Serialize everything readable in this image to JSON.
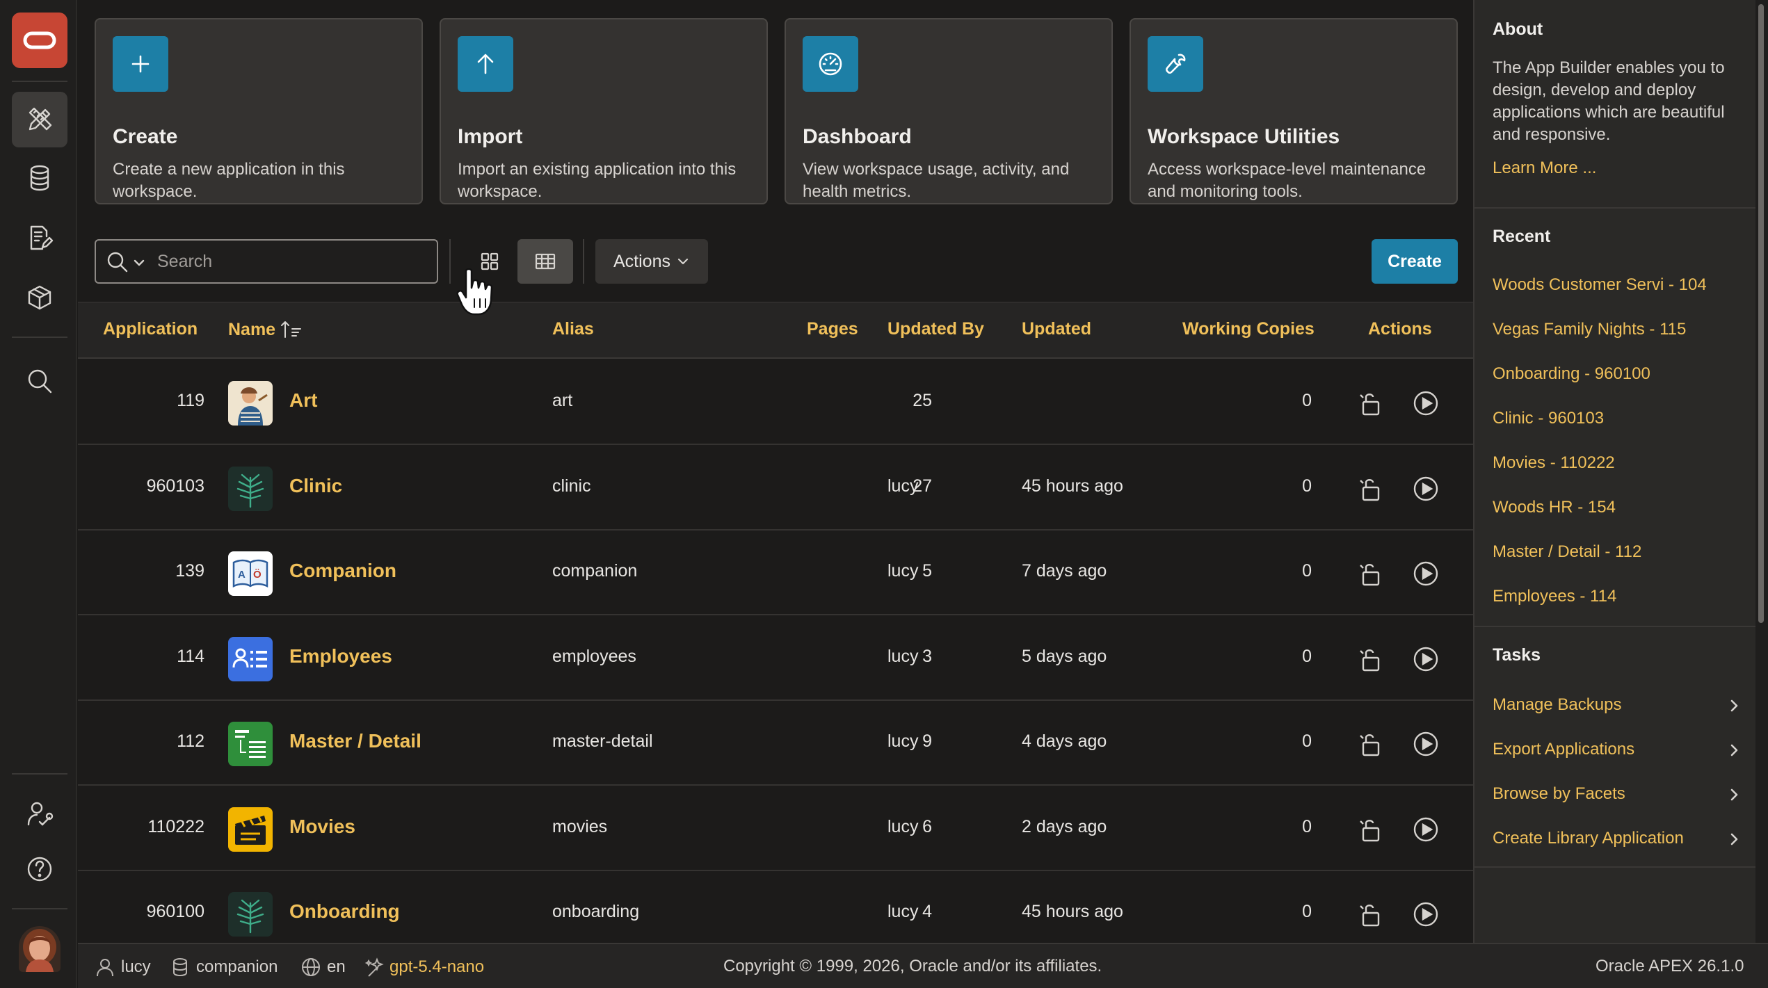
{
  "nav": {
    "items": [
      "app-builder",
      "sql-workshop",
      "team-development",
      "gallery",
      "search",
      "administration",
      "help"
    ]
  },
  "cards": [
    {
      "title": "Create",
      "description": "Create a new application in this workspace.",
      "icon": "plus-icon"
    },
    {
      "title": "Import",
      "description": "Import an existing application into this workspace.",
      "icon": "arrow-up-icon"
    },
    {
      "title": "Dashboard",
      "description": "View workspace usage, activity, and health metrics.",
      "icon": "gauge-icon"
    },
    {
      "title": "Workspace Utilities",
      "description": "Access workspace-level maintenance and monitoring tools.",
      "icon": "wrench-icon"
    }
  ],
  "toolbar": {
    "search_placeholder": "Search",
    "search_value": "",
    "actions_label": "Actions",
    "create_label": "Create",
    "view_mode": "report"
  },
  "table": {
    "columns": {
      "application": "Application",
      "name": "Name",
      "alias": "Alias",
      "pages": "Pages",
      "updated_by": "Updated By",
      "updated": "Updated",
      "working_copies": "Working Copies",
      "actions": "Actions"
    },
    "sort": {
      "column": "Name",
      "direction": "asc"
    },
    "rows": [
      {
        "id": "119",
        "name": "Art",
        "alias": "art",
        "pages": "25",
        "updated_by": "",
        "updated": "",
        "working_copies": "0",
        "icon": "art-icon",
        "icon_color": "#e9dcc4"
      },
      {
        "id": "960103",
        "name": "Clinic",
        "alias": "clinic",
        "pages": "27",
        "updated_by": "lucy",
        "updated": "45 hours ago",
        "working_copies": "0",
        "icon": "leaf-icon",
        "icon_color": "#1e3a33"
      },
      {
        "id": "139",
        "name": "Companion",
        "alias": "companion",
        "pages": "5",
        "updated_by": "lucy",
        "updated": "7 days ago",
        "working_copies": "0",
        "icon": "book-icon",
        "icon_color": "#ffffff"
      },
      {
        "id": "114",
        "name": "Employees",
        "alias": "employees",
        "pages": "3",
        "updated_by": "lucy",
        "updated": "5 days ago",
        "working_copies": "0",
        "icon": "people-list-icon",
        "icon_color": "#3b6fe0"
      },
      {
        "id": "112",
        "name": "Master / Detail",
        "alias": "master-detail",
        "pages": "9",
        "updated_by": "lucy",
        "updated": "4 days ago",
        "working_copies": "0",
        "icon": "master-detail-icon",
        "icon_color": "#2f8f3b"
      },
      {
        "id": "110222",
        "name": "Movies",
        "alias": "movies",
        "pages": "6",
        "updated_by": "lucy",
        "updated": "2 days ago",
        "working_copies": "0",
        "icon": "clapperboard-icon",
        "icon_color": "#f2b400"
      },
      {
        "id": "960100",
        "name": "Onboarding",
        "alias": "onboarding",
        "pages": "4",
        "updated_by": "lucy",
        "updated": "45 hours ago",
        "working_copies": "0",
        "icon": "leaf-icon",
        "icon_color": "#1e3a33"
      }
    ]
  },
  "side": {
    "about_title": "About",
    "about_text": "The App Builder enables you to design, develop and deploy applications which are beautiful and responsive.",
    "learn_more": "Learn More ...",
    "recent_title": "Recent",
    "recent": [
      "Woods Customer Servi - 104",
      "Vegas Family Nights - 115",
      "Onboarding - 960100",
      "Clinic - 960103",
      "Movies - 110222",
      "Woods HR - 154",
      "Master / Detail - 112",
      "Employees - 114"
    ],
    "tasks_title": "Tasks",
    "tasks": [
      "Manage Backups",
      "Export Applications",
      "Browse by Facets",
      "Create Library Application"
    ]
  },
  "footer": {
    "user": "lucy",
    "schema": "companion",
    "language": "en",
    "model": "gpt-5.4-nano",
    "copyright": "Copyright © 1999, 2026, Oracle and/or its affiliates.",
    "version": "Oracle APEX 26.1.0"
  },
  "colors": {
    "accent": "#f0c05a",
    "primary_button": "#1d7fa6",
    "brand": "#c74634",
    "background": "#1c1b1a"
  }
}
